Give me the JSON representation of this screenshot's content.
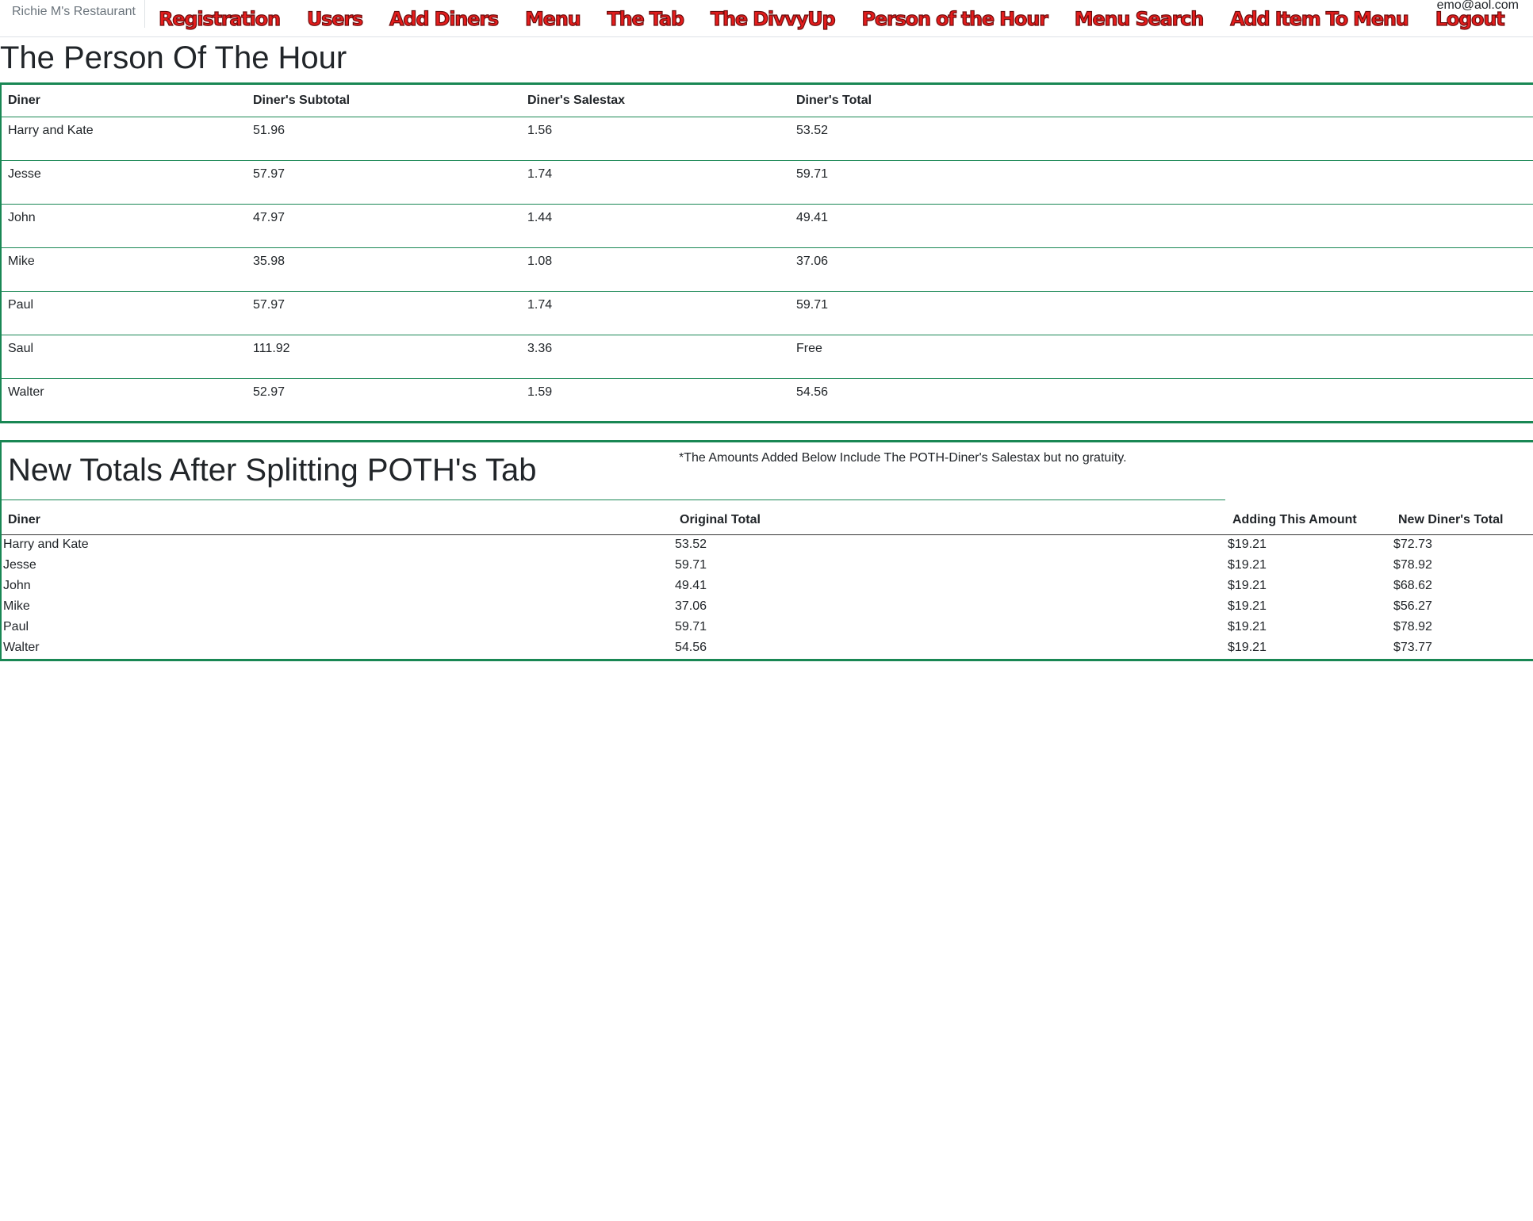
{
  "nav": {
    "brand": "Richie M's Restaurant",
    "links": [
      {
        "label": "Registration"
      },
      {
        "label": "Users"
      },
      {
        "label": "Add Diners"
      },
      {
        "label": "Menu"
      },
      {
        "label": "The Tab"
      },
      {
        "label": "The DivvyUp"
      },
      {
        "label": "Person of the Hour"
      },
      {
        "label": "Menu Search"
      },
      {
        "label": "Add Item To Menu"
      },
      {
        "label": "Logout"
      }
    ],
    "user_email": "emo@aol.com"
  },
  "poth": {
    "title": "The Person Of The Hour",
    "headers": [
      "Diner",
      "Diner's Subtotal",
      "Diner's Salestax",
      "Diner's Total"
    ],
    "rows": [
      [
        "Harry and Kate",
        "51.96",
        "1.56",
        "53.52"
      ],
      [
        "Jesse",
        "57.97",
        "1.74",
        "59.71"
      ],
      [
        "John",
        "47.97",
        "1.44",
        "49.41"
      ],
      [
        "Mike",
        "35.98",
        "1.08",
        "37.06"
      ],
      [
        "Paul",
        "57.97",
        "1.74",
        "59.71"
      ],
      [
        "Saul",
        "111.92",
        "3.36",
        "Free"
      ],
      [
        "Walter",
        "52.97",
        "1.59",
        "54.56"
      ]
    ]
  },
  "split": {
    "title": "New Totals After Splitting POTH's Tab",
    "note": "*The Amounts Added Below Include The POTH-Diner's Salestax but no gratuity.",
    "headers": [
      "Diner",
      "Original Total",
      "Adding This Amount",
      "New Diner's Total"
    ],
    "rows": [
      [
        "Harry and Kate",
        "53.52",
        "$19.21",
        "$72.73"
      ],
      [
        "Jesse",
        "59.71",
        "$19.21",
        "$78.92"
      ],
      [
        "John",
        "49.41",
        "$19.21",
        "$68.62"
      ],
      [
        "Mike",
        "37.06",
        "$19.21",
        "$56.27"
      ],
      [
        "Paul",
        "59.71",
        "$19.21",
        "$78.92"
      ],
      [
        "Walter",
        "54.56",
        "$19.21",
        "$73.77"
      ]
    ]
  },
  "colors": {
    "nav_link": "#e41c1c",
    "table_border": "#198754",
    "text": "#212529"
  }
}
